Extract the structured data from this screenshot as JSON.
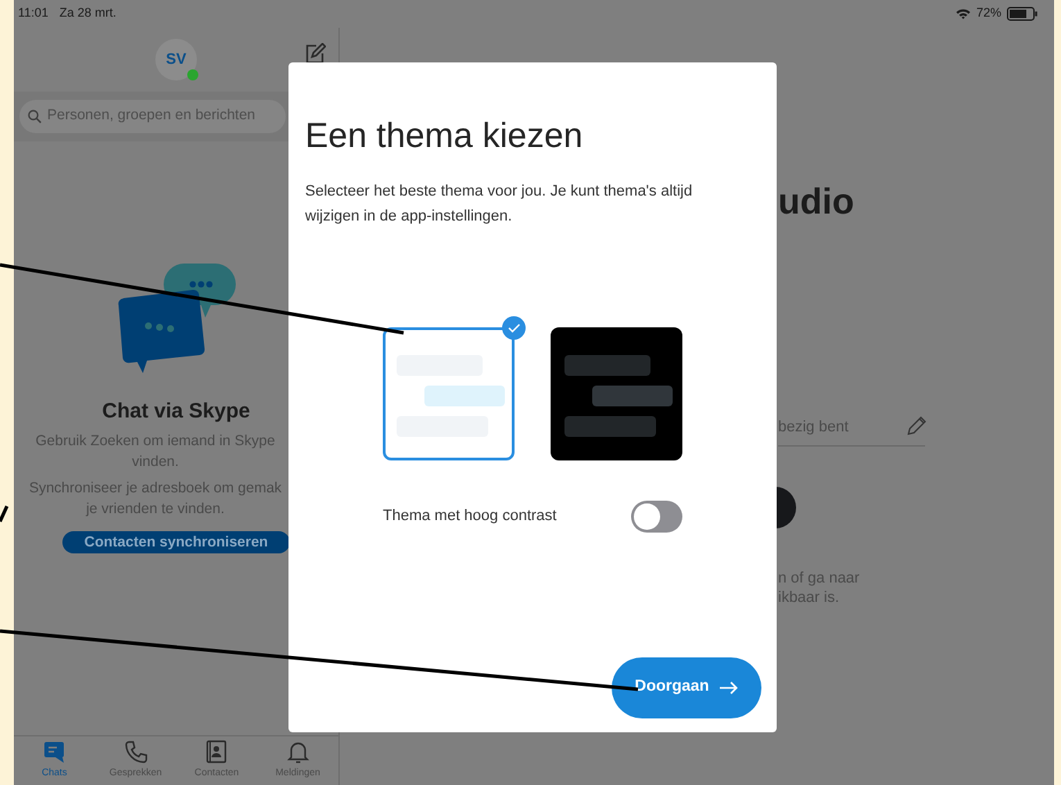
{
  "status_bar": {
    "time": "11:01",
    "date": "Za 28 mrt.",
    "battery": "72%"
  },
  "sidebar": {
    "avatar": {
      "initials": "SV",
      "online": true
    },
    "search": {
      "placeholder": "Personen, groepen en berichten"
    },
    "empty_state": {
      "title": "Chat via Skype",
      "paragraphs": [
        [
          "Gebruik Zoeken om iemand in Skype",
          "vinden."
        ],
        [
          "Synchroniseer je adresboek om gemak",
          "je vrienden te vinden."
        ]
      ],
      "button": "Contacten synchroniseren"
    },
    "tabs": [
      {
        "label": "Chats",
        "kind": "chats",
        "selected": true
      },
      {
        "label": "Gesprekken",
        "kind": "calls",
        "selected": false
      },
      {
        "label": "Contacten",
        "kind": "contacts",
        "selected": false
      },
      {
        "label": "Meldingen",
        "kind": "notifications",
        "selected": false
      }
    ]
  },
  "profile": {
    "name": "udio",
    "mood_placeholder": "bezig bent",
    "info_lines": [
      "n of ga naar",
      "ikbaar is."
    ]
  },
  "dialog": {
    "title": "Een thema kiezen",
    "description": "Selecteer het beste thema voor jou. Je kunt thema's altijd wijzigen in de app-instellingen.",
    "themes": [
      {
        "kind": "light",
        "selected": true
      },
      {
        "kind": "dark",
        "selected": false
      }
    ],
    "high_contrast": {
      "label": "Thema met hoog contrast",
      "on": false
    },
    "continue_button": "Doorgaan"
  }
}
